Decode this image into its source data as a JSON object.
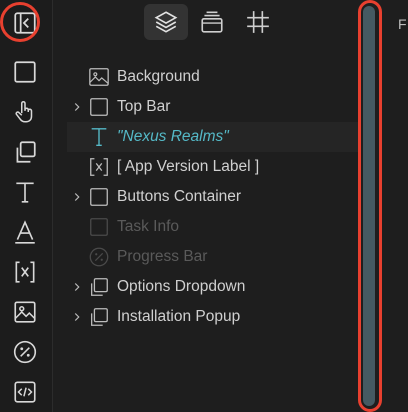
{
  "top_tabs": [
    {
      "icon": "layers-icon",
      "active": true
    },
    {
      "icon": "assets-icon",
      "active": false
    },
    {
      "icon": "frame-icon",
      "active": false
    }
  ],
  "left_tools": [
    "collapse-panel-icon",
    "rectangle-icon",
    "touch-icon",
    "duplicate-icon",
    "text-icon",
    "text-style-icon",
    "variable-icon",
    "image-icon",
    "percent-icon",
    "code-icon"
  ],
  "layers": [
    {
      "label": "Background",
      "icon": "image-icon",
      "expandable": false,
      "dim": false,
      "italic": false,
      "indent": false
    },
    {
      "label": "Top Bar",
      "icon": "frame-square-icon",
      "expandable": true,
      "dim": false,
      "italic": false,
      "indent": false
    },
    {
      "label": "\"Nexus Realms\"",
      "icon": "text-icon",
      "expandable": false,
      "dim": false,
      "italic": true,
      "selected": true
    },
    {
      "label": "[ App Version Label ]",
      "icon": "variable-icon",
      "expandable": false,
      "dim": false,
      "italic": false
    },
    {
      "label": "Buttons Container",
      "icon": "frame-square-icon",
      "expandable": true,
      "dim": false,
      "italic": false
    },
    {
      "label": "Task Info",
      "icon": "frame-square-icon",
      "expandable": false,
      "dim": true,
      "italic": false
    },
    {
      "label": "Progress Bar",
      "icon": "percent-icon",
      "expandable": false,
      "dim": true,
      "italic": false
    },
    {
      "label": "Options Dropdown",
      "icon": "component-icon",
      "expandable": true,
      "dim": false,
      "italic": false
    },
    {
      "label": "Installation Popup",
      "icon": "component-icon",
      "expandable": true,
      "dim": false,
      "italic": false
    }
  ],
  "edge_text": "F",
  "colors": {
    "accent": "#55b9c7",
    "callout": "#e8402f",
    "scroll": "#455a62"
  }
}
